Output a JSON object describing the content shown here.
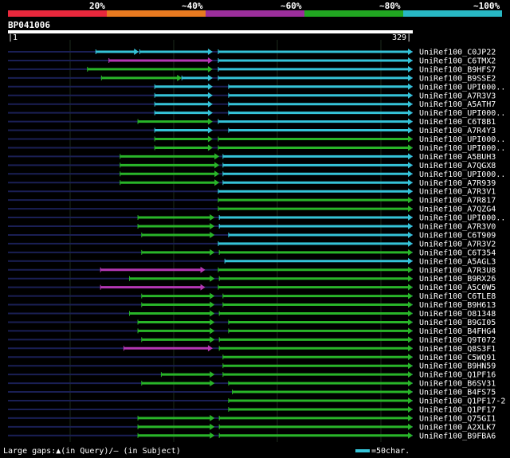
{
  "scale": [
    {
      "label": "20%",
      "color": "#e8283c"
    },
    {
      "label": "~40%",
      "color": "#e87a20"
    },
    {
      "label": "~60%",
      "color": "#9b2e9b"
    },
    {
      "label": "~80%",
      "color": "#21a621"
    },
    {
      "label": "~100%",
      "color": "#28b8c4"
    }
  ],
  "query": {
    "name": "BP041006",
    "start": "1",
    "end": "329"
  },
  "colors": {
    "cyan": "#35c3d8",
    "green": "#29b529",
    "magenta": "#b437b4",
    "nogap": "#1a1f55",
    "grid": "#1c2a1c"
  },
  "hits": [
    {
      "name": "UniRef100_C0JP22",
      "segs": [
        [
          94,
          140,
          "c"
        ],
        [
          141,
          219,
          "c"
        ],
        [
          225,
          433,
          "c"
        ]
      ]
    },
    {
      "name": "UniRef100_C6TMX2",
      "segs": [
        [
          108,
          219,
          "m"
        ],
        [
          225,
          433,
          "c"
        ]
      ]
    },
    {
      "name": "UniRef100_B9HFS7",
      "segs": [
        [
          85,
          219,
          "g"
        ],
        [
          225,
          433,
          "c"
        ]
      ]
    },
    {
      "name": "UniRef100_B9SSE2",
      "segs": [
        [
          100,
          186,
          "g"
        ],
        [
          186,
          219,
          "c"
        ],
        [
          225,
          433,
          "c"
        ]
      ]
    },
    {
      "name": "UniRef100_UPI000..",
      "segs": [
        [
          157,
          219,
          "c"
        ],
        [
          236,
          433,
          "c"
        ]
      ]
    },
    {
      "name": "UniRef100_A7R3V3",
      "segs": [
        [
          157,
          219,
          "c"
        ],
        [
          236,
          433,
          "c"
        ]
      ]
    },
    {
      "name": "UniRef100_A5ATH7",
      "segs": [
        [
          157,
          219,
          "c"
        ],
        [
          236,
          433,
          "c"
        ]
      ]
    },
    {
      "name": "UniRef100_UPI000..",
      "segs": [
        [
          157,
          219,
          "c"
        ],
        [
          236,
          433,
          "c"
        ]
      ]
    },
    {
      "name": "UniRef100_C6T8B1",
      "segs": [
        [
          139,
          219,
          "g"
        ],
        [
          225,
          433,
          "c"
        ]
      ]
    },
    {
      "name": "UniRef100_A7R4Y3",
      "segs": [
        [
          157,
          219,
          "c"
        ],
        [
          236,
          433,
          "c"
        ]
      ]
    },
    {
      "name": "UniRef100_UPI000..",
      "segs": [
        [
          157,
          219,
          "g"
        ],
        [
          225,
          433,
          "g"
        ]
      ]
    },
    {
      "name": "UniRef100_UPI000..",
      "segs": [
        [
          157,
          219,
          "g"
        ],
        [
          225,
          433,
          "g"
        ]
      ]
    },
    {
      "name": "UniRef100_A5BUH3",
      "segs": [
        [
          120,
          226,
          "g"
        ],
        [
          230,
          433,
          "c"
        ]
      ]
    },
    {
      "name": "UniRef100_A7QGX8",
      "segs": [
        [
          120,
          226,
          "g"
        ],
        [
          230,
          433,
          "c"
        ]
      ]
    },
    {
      "name": "UniRef100_UPI000..",
      "segs": [
        [
          120,
          226,
          "g"
        ],
        [
          230,
          433,
          "c"
        ]
      ]
    },
    {
      "name": "UniRef100_A7R939",
      "segs": [
        [
          120,
          226,
          "g"
        ],
        [
          230,
          433,
          "c"
        ]
      ]
    },
    {
      "name": "UniRef100_A7R3V1",
      "segs": [
        [
          225,
          433,
          "c"
        ]
      ]
    },
    {
      "name": "UniRef100_A7R817",
      "segs": [
        [
          225,
          433,
          "g"
        ]
      ]
    },
    {
      "name": "UniRef100_A7QZG4",
      "segs": [
        [
          225,
          433,
          "g"
        ]
      ]
    },
    {
      "name": "UniRef100_UPI000..",
      "segs": [
        [
          139,
          221,
          "g"
        ],
        [
          226,
          433,
          "c"
        ]
      ]
    },
    {
      "name": "UniRef100_A7R3V0",
      "segs": [
        [
          139,
          221,
          "g"
        ],
        [
          226,
          433,
          "c"
        ]
      ]
    },
    {
      "name": "UniRef100_C6T909",
      "segs": [
        [
          143,
          221,
          "g"
        ],
        [
          236,
          433,
          "c"
        ]
      ]
    },
    {
      "name": "UniRef100_A7R3V2",
      "segs": [
        [
          225,
          433,
          "c"
        ]
      ]
    },
    {
      "name": "UniRef100_C6T354",
      "segs": [
        [
          143,
          221,
          "g"
        ],
        [
          226,
          433,
          "g"
        ]
      ]
    },
    {
      "name": "UniRef100_A5AGL3",
      "segs": [
        [
          232,
          433,
          "c"
        ]
      ]
    },
    {
      "name": "UniRef100_A7R3U8",
      "segs": [
        [
          99,
          211,
          "m"
        ],
        [
          225,
          433,
          "g"
        ]
      ]
    },
    {
      "name": "UniRef100_B9RX26",
      "segs": [
        [
          130,
          221,
          "g"
        ],
        [
          226,
          433,
          "g"
        ]
      ]
    },
    {
      "name": "UniRef100_A5C0W5",
      "segs": [
        [
          99,
          211,
          "m"
        ],
        [
          225,
          433,
          "g"
        ]
      ]
    },
    {
      "name": "UniRef100_C6TLE8",
      "segs": [
        [
          143,
          221,
          "g"
        ],
        [
          230,
          433,
          "g"
        ]
      ]
    },
    {
      "name": "UniRef100_B9H613",
      "segs": [
        [
          143,
          221,
          "g"
        ],
        [
          230,
          433,
          "g"
        ]
      ]
    },
    {
      "name": "UniRef100_O81348",
      "segs": [
        [
          130,
          221,
          "g"
        ],
        [
          226,
          433,
          "g"
        ]
      ]
    },
    {
      "name": "UniRef100_B9GI05",
      "segs": [
        [
          139,
          221,
          "g"
        ],
        [
          236,
          433,
          "g"
        ]
      ]
    },
    {
      "name": "UniRef100_B4FHG4",
      "segs": [
        [
          139,
          221,
          "g"
        ],
        [
          236,
          433,
          "g"
        ]
      ]
    },
    {
      "name": "UniRef100_Q9T072",
      "segs": [
        [
          143,
          221,
          "g"
        ],
        [
          226,
          433,
          "g"
        ]
      ]
    },
    {
      "name": "UniRef100_Q8S3F1",
      "segs": [
        [
          124,
          219,
          "m"
        ],
        [
          226,
          433,
          "g"
        ]
      ]
    },
    {
      "name": "UniRef100_C5WQ91",
      "segs": [
        [
          230,
          433,
          "g"
        ]
      ]
    },
    {
      "name": "UniRef100_B9HN59",
      "segs": [
        [
          230,
          433,
          "g"
        ]
      ]
    },
    {
      "name": "UniRef100_Q1PF16",
      "segs": [
        [
          164,
          221,
          "g"
        ],
        [
          230,
          433,
          "g"
        ]
      ]
    },
    {
      "name": "UniRef100_B6SV31",
      "segs": [
        [
          143,
          221,
          "g"
        ],
        [
          236,
          433,
          "g"
        ]
      ]
    },
    {
      "name": "UniRef100_B4FS75",
      "segs": [
        [
          240,
          433,
          "g"
        ]
      ]
    },
    {
      "name": "UniRef100_Q1PF17-2",
      "segs": [
        [
          236,
          433,
          "g"
        ]
      ]
    },
    {
      "name": "UniRef100_Q1PF17",
      "segs": [
        [
          236,
          433,
          "g"
        ]
      ]
    },
    {
      "name": "UniRef100_Q75GI1",
      "segs": [
        [
          139,
          221,
          "g"
        ],
        [
          226,
          433,
          "g"
        ]
      ]
    },
    {
      "name": "UniRef100_A2XLK7",
      "segs": [
        [
          139,
          221,
          "g"
        ],
        [
          226,
          433,
          "g"
        ]
      ]
    },
    {
      "name": "UniRef100_B9FBA6",
      "segs": [
        [
          139,
          221,
          "g"
        ],
        [
          226,
          433,
          "g"
        ]
      ]
    }
  ],
  "legend": {
    "gaps": "Large gaps:▲(in Query)/– (in Subject)",
    "scale": "=50char."
  }
}
